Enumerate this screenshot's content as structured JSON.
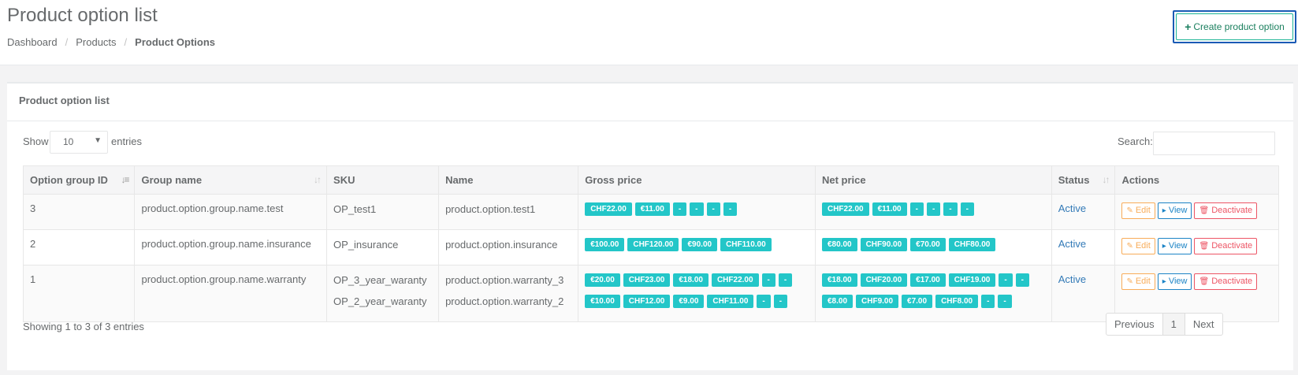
{
  "header": {
    "title": "Product option list",
    "breadcrumb": [
      "Dashboard",
      "Products",
      "Product Options"
    ],
    "create_button": "Create product option"
  },
  "panel": {
    "title": "Product option list",
    "show_label": "Show",
    "entries_value": "10",
    "entries_label": "entries",
    "search_label": "Search:",
    "search_value": ""
  },
  "table": {
    "columns": [
      "Option group ID",
      "Group name",
      "SKU",
      "Name",
      "Gross price",
      "Net price",
      "Status",
      "Actions"
    ],
    "rows": [
      {
        "id": "3",
        "group_name": "product.option.group.name.test",
        "options": [
          {
            "sku": "OP_test1",
            "name": "product.option.test1",
            "gross": [
              "CHF22.00",
              "€11.00",
              "-",
              "-",
              "-",
              "-"
            ],
            "net": [
              "CHF22.00",
              "€11.00",
              "-",
              "-",
              "-",
              "-"
            ]
          }
        ],
        "status": "Active"
      },
      {
        "id": "2",
        "group_name": "product.option.group.name.insurance",
        "options": [
          {
            "sku": "OP_insurance",
            "name": "product.option.insurance",
            "gross": [
              "€100.00",
              "CHF120.00",
              "€90.00",
              "CHF110.00"
            ],
            "net": [
              "€80.00",
              "CHF90.00",
              "€70.00",
              "CHF80.00"
            ]
          }
        ],
        "status": "Active"
      },
      {
        "id": "1",
        "group_name": "product.option.group.name.warranty",
        "options": [
          {
            "sku": "OP_3_year_waranty",
            "name": "product.option.warranty_3",
            "gross": [
              "€20.00",
              "CHF23.00",
              "€18.00",
              "CHF22.00",
              "-",
              "-"
            ],
            "net": [
              "€18.00",
              "CHF20.00",
              "€17.00",
              "CHF19.00",
              "-",
              "-"
            ]
          },
          {
            "sku": "OP_2_year_waranty",
            "name": "product.option.warranty_2",
            "gross": [
              "€10.00",
              "CHF12.00",
              "€9.00",
              "CHF11.00",
              "-",
              "-"
            ],
            "net": [
              "€8.00",
              "CHF9.00",
              "€7.00",
              "CHF8.00",
              "-",
              "-"
            ]
          }
        ],
        "status": "Active"
      }
    ],
    "actions": {
      "edit": "Edit",
      "view": "View",
      "deactivate": "Deactivate"
    }
  },
  "footer": {
    "info": "Showing 1 to 3 of 3 entries",
    "previous": "Previous",
    "page": "1",
    "next": "Next"
  }
}
